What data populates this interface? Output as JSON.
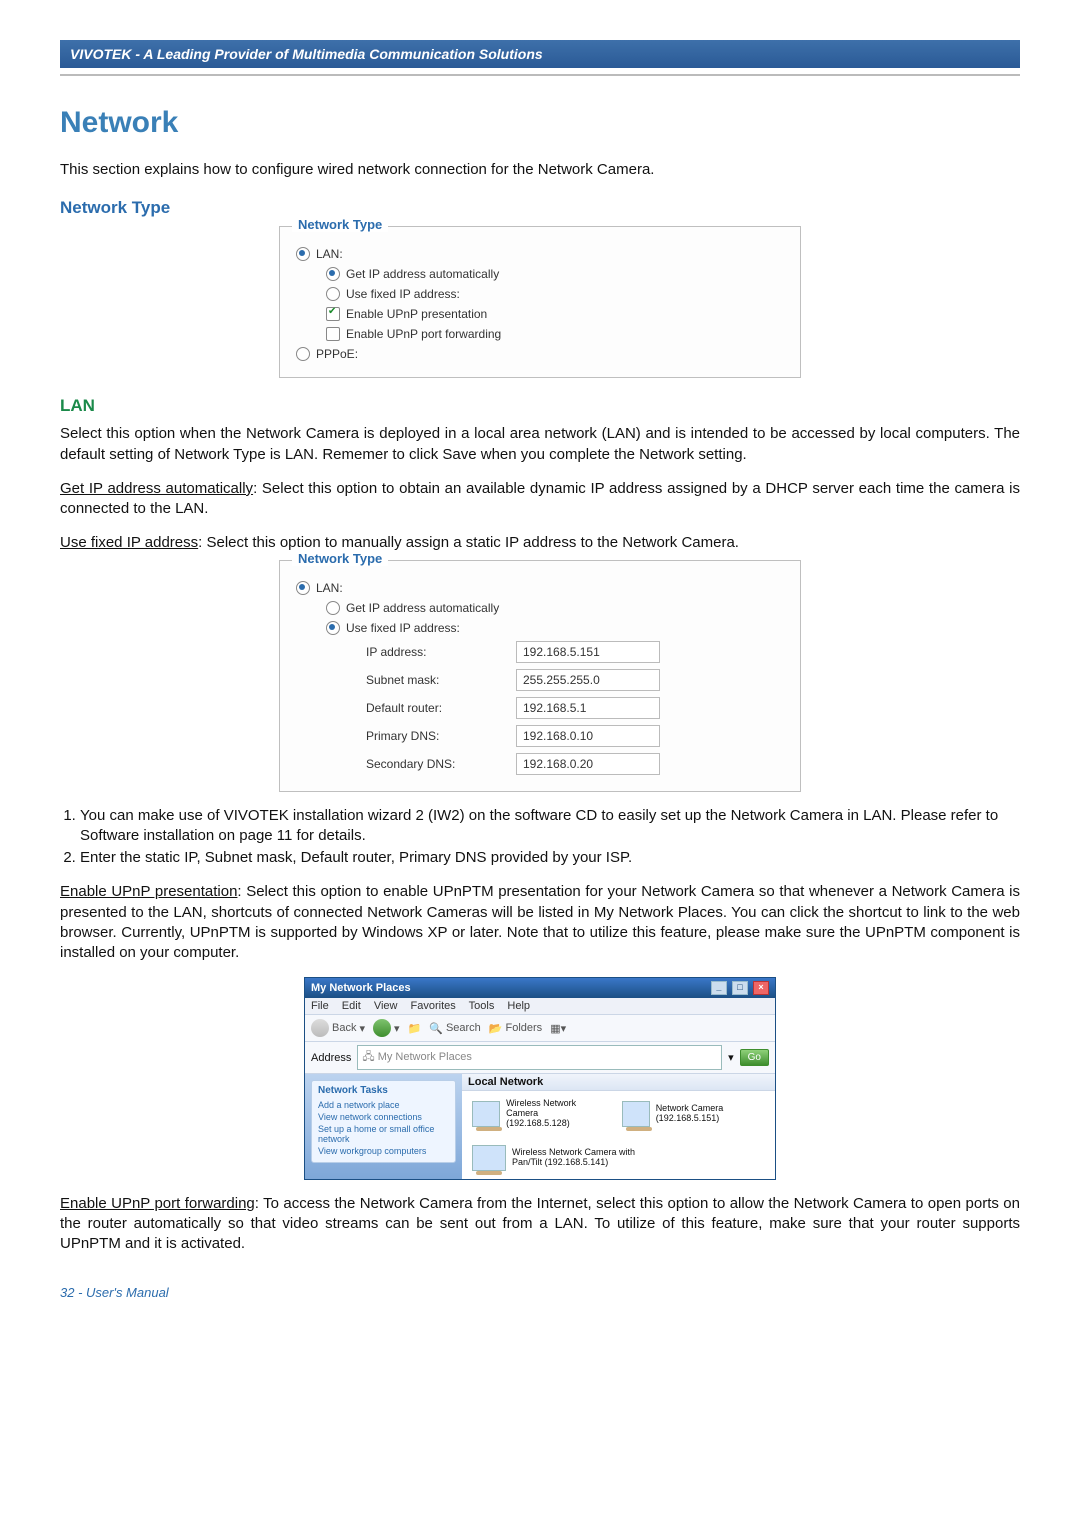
{
  "header": {
    "brand_line": "VIVOTEK - A Leading Provider of Multimedia Communication Solutions"
  },
  "section": {
    "title": "Network",
    "intro": "This section explains how to configure wired network connection for the Network Camera.",
    "subheading_network_type": "Network Type"
  },
  "panel1": {
    "legend": "Network Type",
    "lan_label": "LAN:",
    "opt_auto": "Get IP address automatically",
    "opt_fixed": "Use fixed IP address:",
    "opt_upnp_present": "Enable UPnP presentation",
    "opt_upnp_forward": "Enable UPnP port forwarding",
    "pppoe_label": "PPPoE:"
  },
  "lan": {
    "heading": "LAN",
    "para": "Select this option when the Network Camera is deployed in a local area network (LAN) and is intended to be accessed by local computers. The default setting of Network Type is LAN. Rememer to click Save when you complete the Network setting.",
    "auto_label": "Get IP address automatically",
    "auto_desc": ": Select this option to obtain an available dynamic IP address assigned by a DHCP server each time the camera is connected to the LAN.",
    "fixed_label": "Use fixed IP address",
    "fixed_desc": ": Select this option to manually assign a static IP address to the Network Camera."
  },
  "panel2": {
    "legend": "Network Type",
    "lan_label": "LAN:",
    "opt_auto": "Get IP address automatically",
    "opt_fixed": "Use fixed IP address:",
    "fields": {
      "ip_label": "IP address:",
      "ip_value": "192.168.5.151",
      "subnet_label": "Subnet mask:",
      "subnet_value": "255.255.255.0",
      "router_label": "Default router:",
      "router_value": "192.168.5.1",
      "pridns_label": "Primary DNS:",
      "pridns_value": "192.168.0.10",
      "secdns_label": "Secondary DNS:",
      "secdns_value": "192.168.0.20"
    }
  },
  "steps": {
    "s1": "You can make use of VIVOTEK installation wizard 2 (IW2) on the software CD to easily set up the Network Camera in LAN. Please refer to Software installation on page 11 for details.",
    "s2": "Enter the static IP, Subnet mask, Default router, Primary DNS provided by your ISP."
  },
  "upnp_present": {
    "label": "Enable UPnP presentation",
    "desc": ": Select this option to enable UPnPTM presentation for your Network Camera so that whenever a Network Camera is presented to the LAN, shortcuts of connected Network Cameras will be listed in My Network Places. You can click the shortcut to link to the web browser. Currently, UPnPTM is supported by Windows XP or later. Note that to utilize this feature, please make sure the UPnPTM component is installed on your computer."
  },
  "win": {
    "title": "My Network Places",
    "menu": {
      "file": "File",
      "edit": "Edit",
      "view": "View",
      "favorites": "Favorites",
      "tools": "Tools",
      "help": "Help"
    },
    "toolbar": {
      "back": "Back",
      "search": "Search",
      "folders": "Folders"
    },
    "addr": {
      "label": "Address",
      "value": "My Network Places",
      "go": "Go"
    },
    "side": {
      "heading": "Network Tasks",
      "l1": "Add a network place",
      "l2": "View network connections",
      "l3": "Set up a home or small office network",
      "l4": "View workgroup computers"
    },
    "main": {
      "group": "Local Network",
      "item1_line1": "Wireless Network Camera",
      "item1_line2": "(192.168.5.128)",
      "item2": "Network Camera (192.168.5.151)",
      "item3_line1": "Wireless Network Camera with",
      "item3_line2": "Pan/Tilt (192.168.5.141)"
    }
  },
  "upnp_forward": {
    "label": "Enable UPnP port forwarding",
    "desc": ": To access the Network Camera from the Internet, select this option to allow the Network Camera to open ports on the router automatically so that video streams can be sent out from a LAN. To utilize of this feature, make sure that your router supports UPnPTM and it is activated."
  },
  "footer": {
    "text": "32 - User's Manual"
  }
}
